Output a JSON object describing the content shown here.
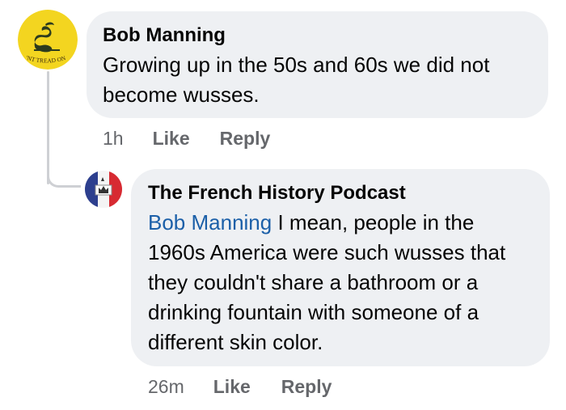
{
  "thread": {
    "comment": {
      "author": "Bob Manning",
      "text": "Growing up in the 50s and 60s we did not become wusses.",
      "time": "1h",
      "like_label": "Like",
      "reply_label": "Reply",
      "avatar_icon": "gadsden-flag-icon",
      "avatar_text": "'NT TREAD ON",
      "avatar_bg": "#f3d520"
    },
    "reply": {
      "author": "The French History Podcast",
      "mention": "Bob Manning",
      "text": " I mean, people in the 1960s America were such wusses that they couldn't share a bathroom or a drinking fountain with someone of a different skin color.",
      "time": "26m",
      "like_label": "Like",
      "reply_label": "Reply",
      "avatar_icon": "french-flag-icon"
    },
    "colors": {
      "bubble": "#eef0f3",
      "mention": "#1b5fa8",
      "meta": "#65676b",
      "thread_line": "#ced0d4"
    }
  }
}
